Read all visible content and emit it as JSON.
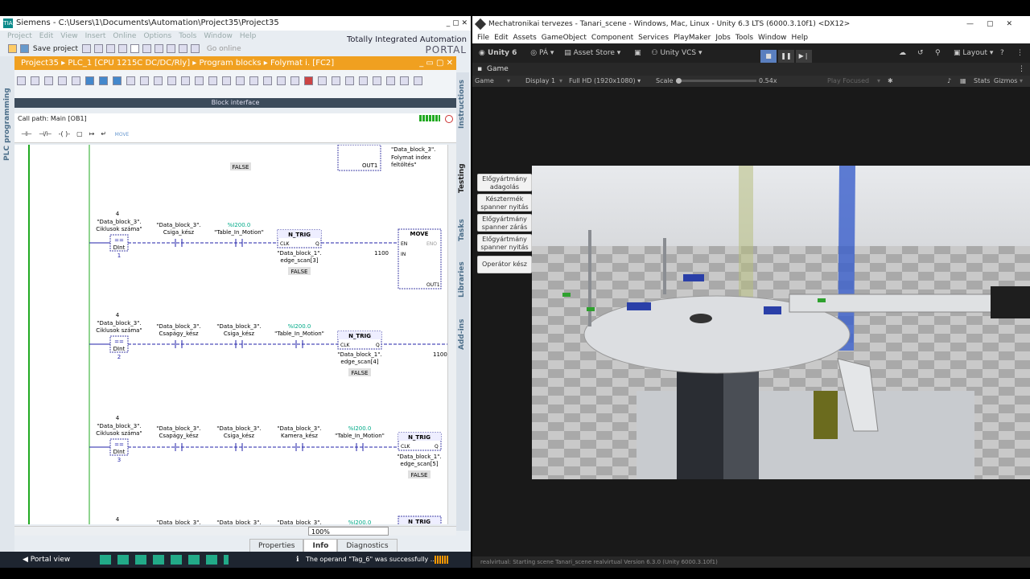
{
  "tia": {
    "title": "Siemens  -  C:\\Users\\1\\Documents\\Automation\\Project35\\Project35",
    "menu": [
      "Project",
      "Edit",
      "View",
      "Insert",
      "Online",
      "Options",
      "Tools",
      "Window",
      "Help"
    ],
    "save_label": "Save project",
    "go_online": "Go online",
    "brand_line1": "Totally Integrated Automation",
    "brand_line2": "PORTAL",
    "left_tab": "PLC programming",
    "breadcrumb": "Project35  ▸  PLC_1 [CPU 1215C DC/DC/Rly]  ▸  Program blocks  ▸  Folymat i. [FC2]",
    "block_interface": "Block interface",
    "call_path": "Call path: Main [OB1]",
    "move_label": "MOVE",
    "right_tabs": [
      "Instructions",
      "Testing",
      "Tasks",
      "Libraries",
      "Add-ins"
    ],
    "zoom": "100%",
    "bottom_tabs": [
      "Properties",
      "Info",
      "Diagnostics"
    ],
    "portal_view": "Portal view",
    "status_msg": "The operand \"Tag_6\" was successfully ...",
    "ladder": {
      "top_false": "FALSE",
      "top_out": "OUT1",
      "top_db": "\"Data_block_3\".",
      "top_db2": "Folymat index",
      "top_db3": "feltöltés\"",
      "net_num": "4",
      "cmp_db": "\"Data_block_3\".",
      "cmp_name": "Ciklusok száma\"",
      "cmp_op": "==",
      "cmp_type": "DInt",
      "csapagy": "Csapágy_kész",
      "csiga": "Csiga_kész",
      "kamera": "Kamera_kész",
      "db3": "\"Data_block_3\".",
      "tim_addr": "%I200.0",
      "tim_name": "\"Table_In_Motion\"",
      "ntrig": "N_TRIG",
      "clk": "CLK",
      "q": "Q",
      "db1": "\"Data_block_1\".",
      "scan3": "edge_scan[3]",
      "scan4": "edge_scan[4]",
      "scan5": "edge_scan[5]",
      "false": "FALSE",
      "move": "MOVE",
      "en": "EN",
      "eno": "ENO",
      "in": "IN",
      "out1": "OUT1",
      "val1100": "1100",
      "n1": "1",
      "n2": "2",
      "n3": "3"
    }
  },
  "unity": {
    "title": "Mechatronikai tervezes - Tanari_scene - Windows, Mac, Linux - Unity 6.3 LTS (6000.3.10f1) <DX12>",
    "menu": [
      "File",
      "Edit",
      "Assets",
      "GameObject",
      "Component",
      "Services",
      "PlayMaker",
      "Jobs",
      "Tools",
      "Window",
      "Help"
    ],
    "unity6": "Unity 6",
    "pa": "PÁ",
    "asset_store": "Asset Store",
    "vcs": "Unity VCS",
    "layout": "Layout",
    "game_tab": "Game",
    "game_dd": "Game",
    "display": "Display 1",
    "resolution": "Full HD (1920x1080)",
    "scale_label": "Scale",
    "scale_val": "0.54x",
    "play_focused": "Play Focused",
    "stats": "Stats",
    "gizmos": "Gizmos",
    "buttons": [
      [
        "Előgyártmány",
        "adagolás"
      ],
      [
        "Késztermék",
        "spanner nyitás"
      ],
      [
        "Előgyártmány",
        "spanner zárás"
      ],
      [
        "Előgyártmány",
        "spanner nyitás"
      ],
      [
        "Operátor kész",
        ""
      ]
    ],
    "console": "realvirtual: Starting scene Tanari_scene realvirtual Version 6.3.0 (Unity 6000.3.10f1)"
  }
}
